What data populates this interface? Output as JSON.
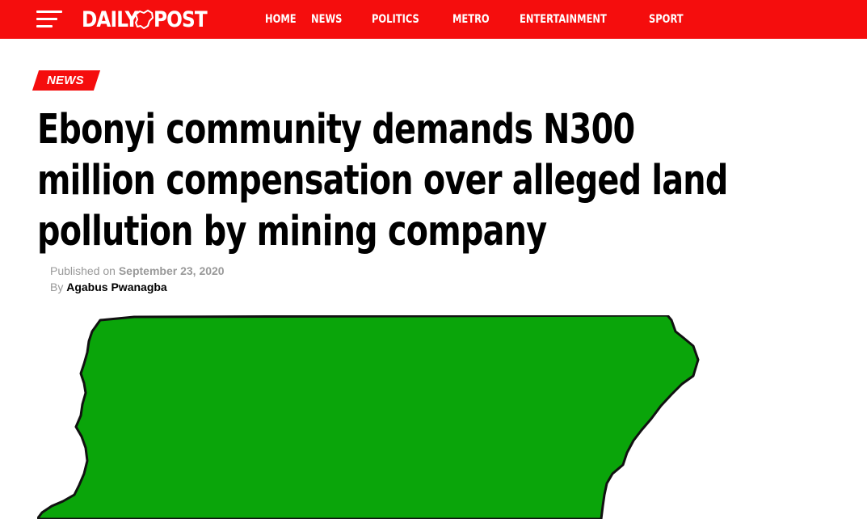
{
  "header": {
    "brand_left": "DAILY",
    "brand_right": "POST",
    "menu_icon": "hamburger-menu-icon",
    "logo_icon": "nigeria-map-icon",
    "colors": {
      "bar": "#f50d0d",
      "text": "#ffffff"
    },
    "nav": [
      {
        "label": "HOME"
      },
      {
        "label": "NEWS"
      },
      {
        "label": "POLITICS"
      },
      {
        "label": "METRO"
      },
      {
        "label": "ENTERTAINMENT"
      },
      {
        "label": "SPORT"
      }
    ]
  },
  "article": {
    "category": "NEWS",
    "title": "Ebonyi community demands N300 million compensation over alleged land pollution by mining company",
    "published_prefix": "Published on",
    "published_date": "September 23, 2020",
    "by_prefix": "By",
    "author": "Agabus Pwanagba",
    "image_colors": {
      "map_fill": "#0aa50a",
      "outline": "#111111"
    }
  }
}
